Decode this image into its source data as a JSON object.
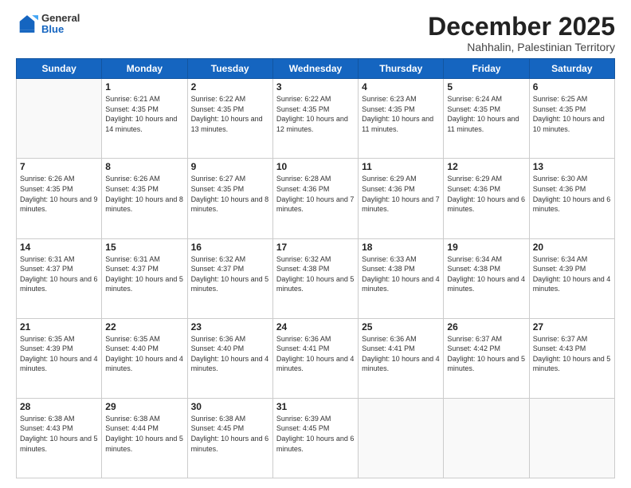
{
  "header": {
    "logo_general": "General",
    "logo_blue": "Blue",
    "month_title": "December 2025",
    "location": "Nahhalin, Palestinian Territory"
  },
  "weekdays": [
    "Sunday",
    "Monday",
    "Tuesday",
    "Wednesday",
    "Thursday",
    "Friday",
    "Saturday"
  ],
  "weeks": [
    [
      {
        "day": "",
        "sunrise": "",
        "sunset": "",
        "daylight": ""
      },
      {
        "day": "1",
        "sunrise": "6:21 AM",
        "sunset": "4:35 PM",
        "daylight": "10 hours and 14 minutes."
      },
      {
        "day": "2",
        "sunrise": "6:22 AM",
        "sunset": "4:35 PM",
        "daylight": "10 hours and 13 minutes."
      },
      {
        "day": "3",
        "sunrise": "6:22 AM",
        "sunset": "4:35 PM",
        "daylight": "10 hours and 12 minutes."
      },
      {
        "day": "4",
        "sunrise": "6:23 AM",
        "sunset": "4:35 PM",
        "daylight": "10 hours and 11 minutes."
      },
      {
        "day": "5",
        "sunrise": "6:24 AM",
        "sunset": "4:35 PM",
        "daylight": "10 hours and 11 minutes."
      },
      {
        "day": "6",
        "sunrise": "6:25 AM",
        "sunset": "4:35 PM",
        "daylight": "10 hours and 10 minutes."
      }
    ],
    [
      {
        "day": "7",
        "sunrise": "6:26 AM",
        "sunset": "4:35 PM",
        "daylight": "10 hours and 9 minutes."
      },
      {
        "day": "8",
        "sunrise": "6:26 AM",
        "sunset": "4:35 PM",
        "daylight": "10 hours and 8 minutes."
      },
      {
        "day": "9",
        "sunrise": "6:27 AM",
        "sunset": "4:35 PM",
        "daylight": "10 hours and 8 minutes."
      },
      {
        "day": "10",
        "sunrise": "6:28 AM",
        "sunset": "4:36 PM",
        "daylight": "10 hours and 7 minutes."
      },
      {
        "day": "11",
        "sunrise": "6:29 AM",
        "sunset": "4:36 PM",
        "daylight": "10 hours and 7 minutes."
      },
      {
        "day": "12",
        "sunrise": "6:29 AM",
        "sunset": "4:36 PM",
        "daylight": "10 hours and 6 minutes."
      },
      {
        "day": "13",
        "sunrise": "6:30 AM",
        "sunset": "4:36 PM",
        "daylight": "10 hours and 6 minutes."
      }
    ],
    [
      {
        "day": "14",
        "sunrise": "6:31 AM",
        "sunset": "4:37 PM",
        "daylight": "10 hours and 6 minutes."
      },
      {
        "day": "15",
        "sunrise": "6:31 AM",
        "sunset": "4:37 PM",
        "daylight": "10 hours and 5 minutes."
      },
      {
        "day": "16",
        "sunrise": "6:32 AM",
        "sunset": "4:37 PM",
        "daylight": "10 hours and 5 minutes."
      },
      {
        "day": "17",
        "sunrise": "6:32 AM",
        "sunset": "4:38 PM",
        "daylight": "10 hours and 5 minutes."
      },
      {
        "day": "18",
        "sunrise": "6:33 AM",
        "sunset": "4:38 PM",
        "daylight": "10 hours and 4 minutes."
      },
      {
        "day": "19",
        "sunrise": "6:34 AM",
        "sunset": "4:38 PM",
        "daylight": "10 hours and 4 minutes."
      },
      {
        "day": "20",
        "sunrise": "6:34 AM",
        "sunset": "4:39 PM",
        "daylight": "10 hours and 4 minutes."
      }
    ],
    [
      {
        "day": "21",
        "sunrise": "6:35 AM",
        "sunset": "4:39 PM",
        "daylight": "10 hours and 4 minutes."
      },
      {
        "day": "22",
        "sunrise": "6:35 AM",
        "sunset": "4:40 PM",
        "daylight": "10 hours and 4 minutes."
      },
      {
        "day": "23",
        "sunrise": "6:36 AM",
        "sunset": "4:40 PM",
        "daylight": "10 hours and 4 minutes."
      },
      {
        "day": "24",
        "sunrise": "6:36 AM",
        "sunset": "4:41 PM",
        "daylight": "10 hours and 4 minutes."
      },
      {
        "day": "25",
        "sunrise": "6:36 AM",
        "sunset": "4:41 PM",
        "daylight": "10 hours and 4 minutes."
      },
      {
        "day": "26",
        "sunrise": "6:37 AM",
        "sunset": "4:42 PM",
        "daylight": "10 hours and 5 minutes."
      },
      {
        "day": "27",
        "sunrise": "6:37 AM",
        "sunset": "4:43 PM",
        "daylight": "10 hours and 5 minutes."
      }
    ],
    [
      {
        "day": "28",
        "sunrise": "6:38 AM",
        "sunset": "4:43 PM",
        "daylight": "10 hours and 5 minutes."
      },
      {
        "day": "29",
        "sunrise": "6:38 AM",
        "sunset": "4:44 PM",
        "daylight": "10 hours and 5 minutes."
      },
      {
        "day": "30",
        "sunrise": "6:38 AM",
        "sunset": "4:45 PM",
        "daylight": "10 hours and 6 minutes."
      },
      {
        "day": "31",
        "sunrise": "6:39 AM",
        "sunset": "4:45 PM",
        "daylight": "10 hours and 6 minutes."
      },
      {
        "day": "",
        "sunrise": "",
        "sunset": "",
        "daylight": ""
      },
      {
        "day": "",
        "sunrise": "",
        "sunset": "",
        "daylight": ""
      },
      {
        "day": "",
        "sunrise": "",
        "sunset": "",
        "daylight": ""
      }
    ]
  ]
}
